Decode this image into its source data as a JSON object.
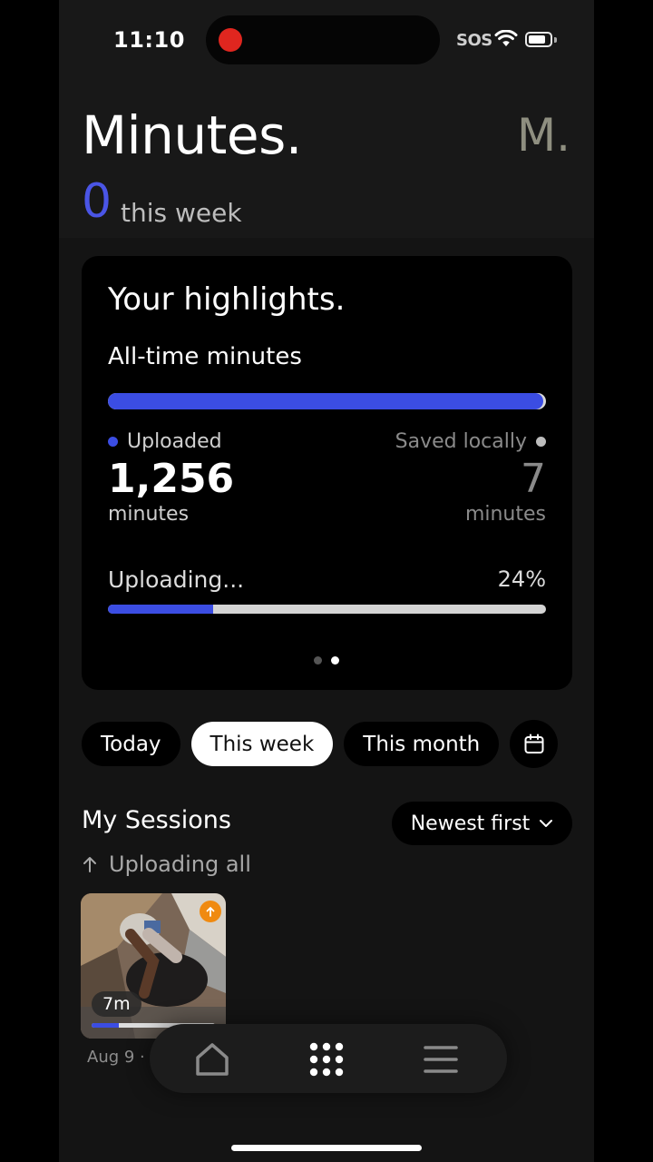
{
  "status_bar": {
    "time": "11:10",
    "carrier": "SOS",
    "icons": [
      "recording-indicator-icon",
      "wifi-icon",
      "battery-icon"
    ]
  },
  "header": {
    "title": "Minutes.",
    "avatar_label": "M.",
    "week_count": "0",
    "week_label": "this week"
  },
  "highlights": {
    "title": "Your highlights.",
    "alltime_label": "All-time minutes",
    "alltime_uploaded_fraction": 0.994,
    "uploaded": {
      "label": "Uploaded",
      "value": "1,256",
      "unit": "minutes"
    },
    "saved": {
      "label": "Saved locally",
      "value": "7",
      "unit": "minutes"
    },
    "uploading": {
      "label": "Uploading...",
      "percent_text": "24%",
      "progress": 0.24
    },
    "pager": {
      "pages": 2,
      "active": 1
    }
  },
  "filters": {
    "items": [
      "Today",
      "This week",
      "This month"
    ],
    "selected": "This week",
    "calendar_icon": "calendar-icon"
  },
  "sessions": {
    "title": "My Sessions",
    "sort_label": "Newest first",
    "upload_all_label": "Uploading all",
    "items": [
      {
        "duration": "7m",
        "date": "Aug 9 ·",
        "upload_progress": 0.22,
        "status_icon": "upload-arrow-icon"
      }
    ]
  },
  "bottom_nav": {
    "items": [
      "home-icon",
      "grid-icon",
      "menu-icon"
    ],
    "active": "grid-icon"
  },
  "colors": {
    "accent": "#3b4de3",
    "badge": "#f08a10"
  }
}
